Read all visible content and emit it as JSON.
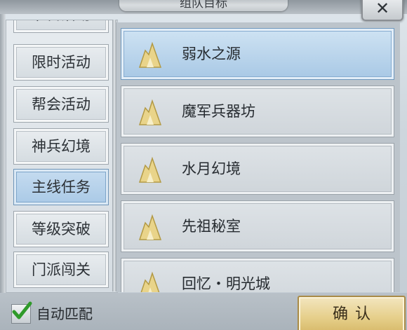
{
  "dialog": {
    "title": "组队目标",
    "close_label": "✕"
  },
  "nav": {
    "items": [
      {
        "label": "节日活动",
        "selected": false
      },
      {
        "label": "限时活动",
        "selected": false
      },
      {
        "label": "帮会活动",
        "selected": false
      },
      {
        "label": "神兵幻境",
        "selected": false
      },
      {
        "label": "主线任务",
        "selected": true
      },
      {
        "label": "等级突破",
        "selected": false
      },
      {
        "label": "门派闯关",
        "selected": false
      }
    ]
  },
  "list": {
    "items": [
      {
        "label": "弱水之源",
        "icon": "mountain-icon",
        "selected": true
      },
      {
        "label": "魔军兵器坊",
        "icon": "mountain-icon",
        "selected": false
      },
      {
        "label": "水月幻境",
        "icon": "mountain-icon",
        "selected": false
      },
      {
        "label": "先祖秘室",
        "icon": "mountain-icon",
        "selected": false
      },
      {
        "label": "回忆・明光城",
        "icon": "mountain-icon",
        "selected": false
      }
    ]
  },
  "footer": {
    "auto_match_label": "自动匹配",
    "auto_match_checked": true,
    "confirm_label": "确认"
  },
  "colors": {
    "selected_blue": "#a9c9e6",
    "confirm_gold": "#e6cf8b",
    "check_green": "#2f9a2a"
  }
}
